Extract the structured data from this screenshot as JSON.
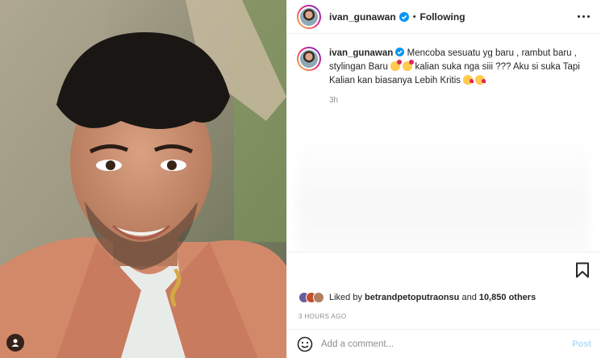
{
  "header": {
    "username": "ivan_gunawan",
    "separator": "•",
    "follow_status": "Following"
  },
  "caption": {
    "username": "ivan_gunawan",
    "text_part1": "Mencoba sesuatu yg baru , rambut baru , stylingan Baru",
    "text_part2": "kalian suka nga siii ??? Aku si suka Tapi Kalian kan biasanya Lebih Kritis",
    "time": "3h"
  },
  "likes": {
    "prefix": "Liked by",
    "user": "betrandpetoputraonsu",
    "middle": "and",
    "count": "10,850 others"
  },
  "timestamp": "3 HOURS AGO",
  "comment": {
    "placeholder": "Add a comment...",
    "post_label": "Post"
  },
  "icons": {
    "verified": "verified-badge-icon",
    "more": "more-options-icon",
    "bookmark": "bookmark-icon",
    "emoji": "emoji-icon",
    "user_tag": "user-tag-icon"
  },
  "colors": {
    "verified_blue": "#0095f6",
    "post_disabled": "#b2dffc",
    "muted": "#8e8e8e",
    "text": "#262626"
  }
}
